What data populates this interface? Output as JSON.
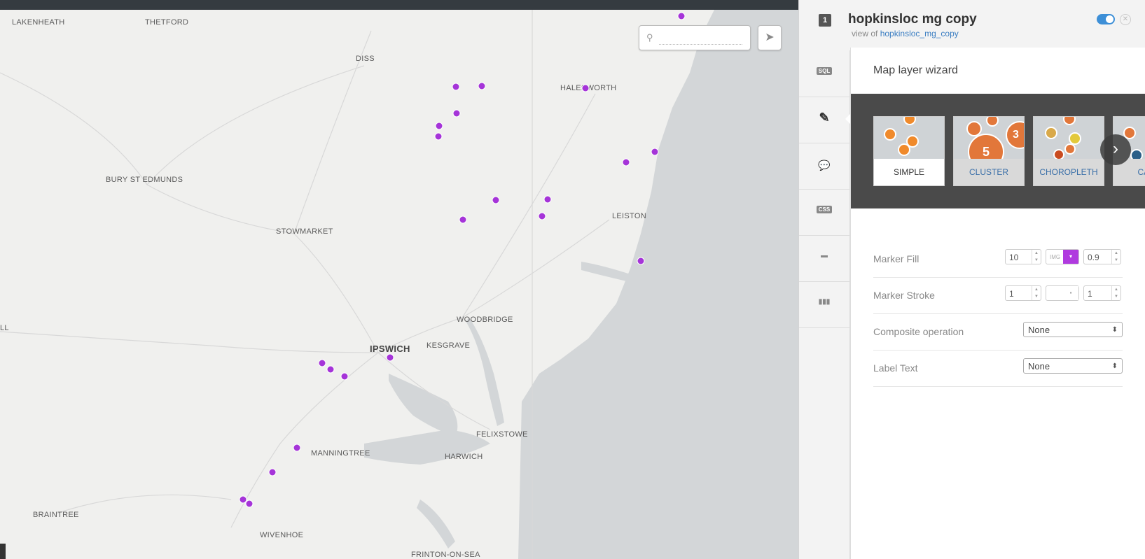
{
  "map": {
    "places": [
      {
        "name": "LAKENHEATH"
      },
      {
        "name": "THETFORD"
      },
      {
        "name": "DISS"
      },
      {
        "name": "HALESWORTH"
      },
      {
        "name": "BURY ST EDMUNDS"
      },
      {
        "name": "STOWMARKET"
      },
      {
        "name": "LEISTON"
      },
      {
        "name": "WOODBRIDGE"
      },
      {
        "name": "IPSWICH"
      },
      {
        "name": "KESGRAVE"
      },
      {
        "name": "FELIXSTOWE"
      },
      {
        "name": "MANNINGTREE"
      },
      {
        "name": "HARWICH"
      },
      {
        "name": "BRAINTREE"
      },
      {
        "name": "WIVENHOE"
      },
      {
        "name": "FRINTON-ON-SEA"
      },
      {
        "name": "LL"
      }
    ],
    "marker_color": "#a534d8",
    "search": {
      "value": "",
      "placeholder": ""
    }
  },
  "panel": {
    "layer_number": "1",
    "title": "hopkinsloc mg copy",
    "view_of_prefix": "view of",
    "view_of_link": "hopkinsloc_mg_copy",
    "visible": true,
    "tools": [
      {
        "name": "sql",
        "label": "SQL"
      },
      {
        "name": "wizard",
        "label": "✎"
      },
      {
        "name": "infowindow",
        "label": "💬"
      },
      {
        "name": "css",
        "label": "CSS"
      },
      {
        "name": "legend",
        "label": "▬"
      },
      {
        "name": "filters",
        "label": "▮▮▮"
      }
    ],
    "wizard": {
      "title": "Map layer wizard",
      "types": [
        {
          "label": "SIMPLE",
          "selected": true
        },
        {
          "label": "CLUSTER",
          "selected": false
        },
        {
          "label": "CHOROPLETH",
          "selected": false
        },
        {
          "label": "CATE",
          "selected": false
        }
      ],
      "cluster_numbers": [
        "5",
        "3"
      ],
      "rows": {
        "marker_fill": {
          "label": "Marker Fill",
          "size": "10",
          "img": "IMG",
          "color": "#a534d8",
          "opacity": "0.9"
        },
        "marker_stroke": {
          "label": "Marker Stroke",
          "width": "1",
          "color": "#ffffff",
          "opacity": "1"
        },
        "composite": {
          "label": "Composite operation",
          "value": "None"
        },
        "label_text": {
          "label": "Label Text",
          "value": "None"
        }
      }
    }
  }
}
